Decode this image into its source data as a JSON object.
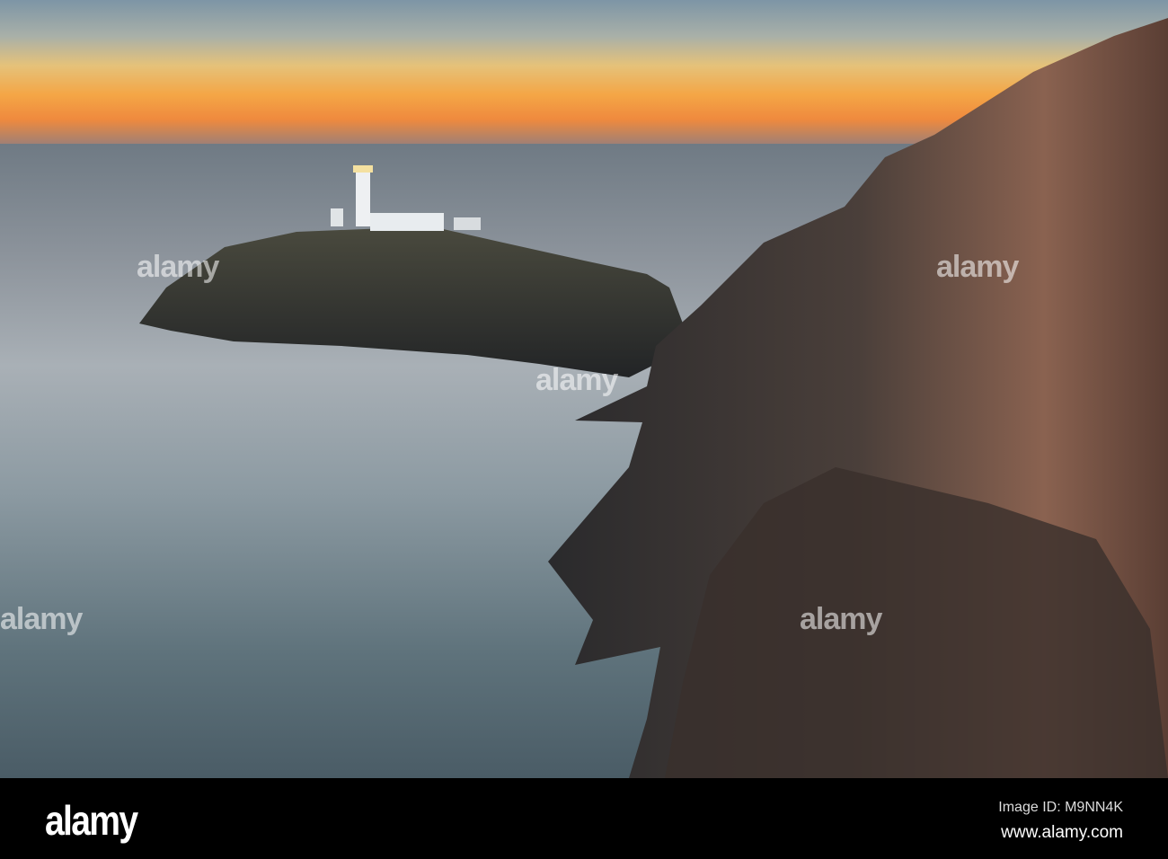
{
  "watermark": {
    "text": "alamy"
  },
  "footer": {
    "logo": "alamy",
    "image_id": "Image ID: M9NN4K",
    "website": "www.alamy.com"
  }
}
